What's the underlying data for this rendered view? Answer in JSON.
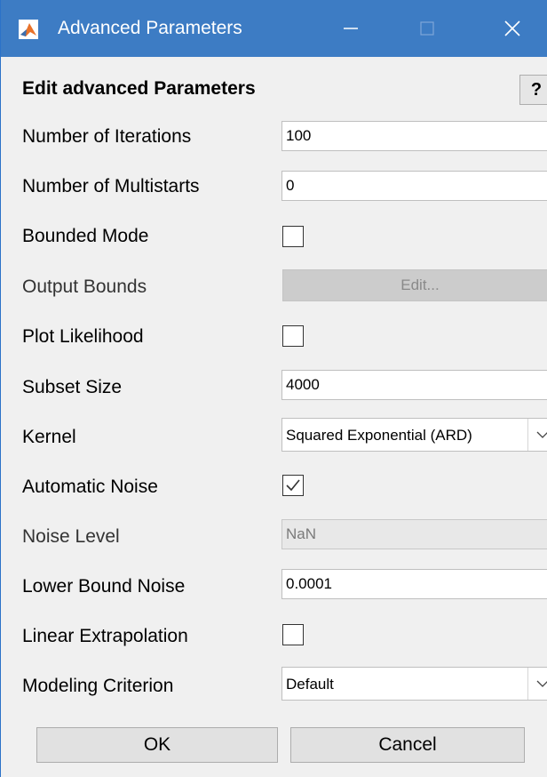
{
  "window": {
    "title": "Advanced Parameters",
    "heading": "Edit advanced Parameters",
    "help_label": "?"
  },
  "rows": {
    "iterations": {
      "label": "Number of Iterations",
      "value": "100"
    },
    "multistarts": {
      "label": "Number of Multistarts",
      "value": "0"
    },
    "bounded_mode": {
      "label": "Bounded Mode",
      "checked": false
    },
    "output_bounds": {
      "label": "Output Bounds",
      "button_label": "Edit..."
    },
    "plot_likelihood": {
      "label": "Plot Likelihood",
      "checked": false
    },
    "subset_size": {
      "label": "Subset Size",
      "value": "4000"
    },
    "kernel": {
      "label": "Kernel",
      "value": "Squared Exponential (ARD)"
    },
    "automatic_noise": {
      "label": "Automatic Noise",
      "checked": true
    },
    "noise_level": {
      "label": "Noise Level",
      "value": "NaN"
    },
    "lower_bound_noise": {
      "label": "Lower Bound Noise",
      "value": "0.0001"
    },
    "linear_extrapolation": {
      "label": "Linear Extrapolation",
      "checked": false
    },
    "modeling_criterion": {
      "label": "Modeling Criterion",
      "value": "Default"
    }
  },
  "buttons": {
    "ok": "OK",
    "cancel": "Cancel"
  },
  "colors": {
    "titlebar": "#3d7cc4",
    "background": "#f0f0f0"
  }
}
